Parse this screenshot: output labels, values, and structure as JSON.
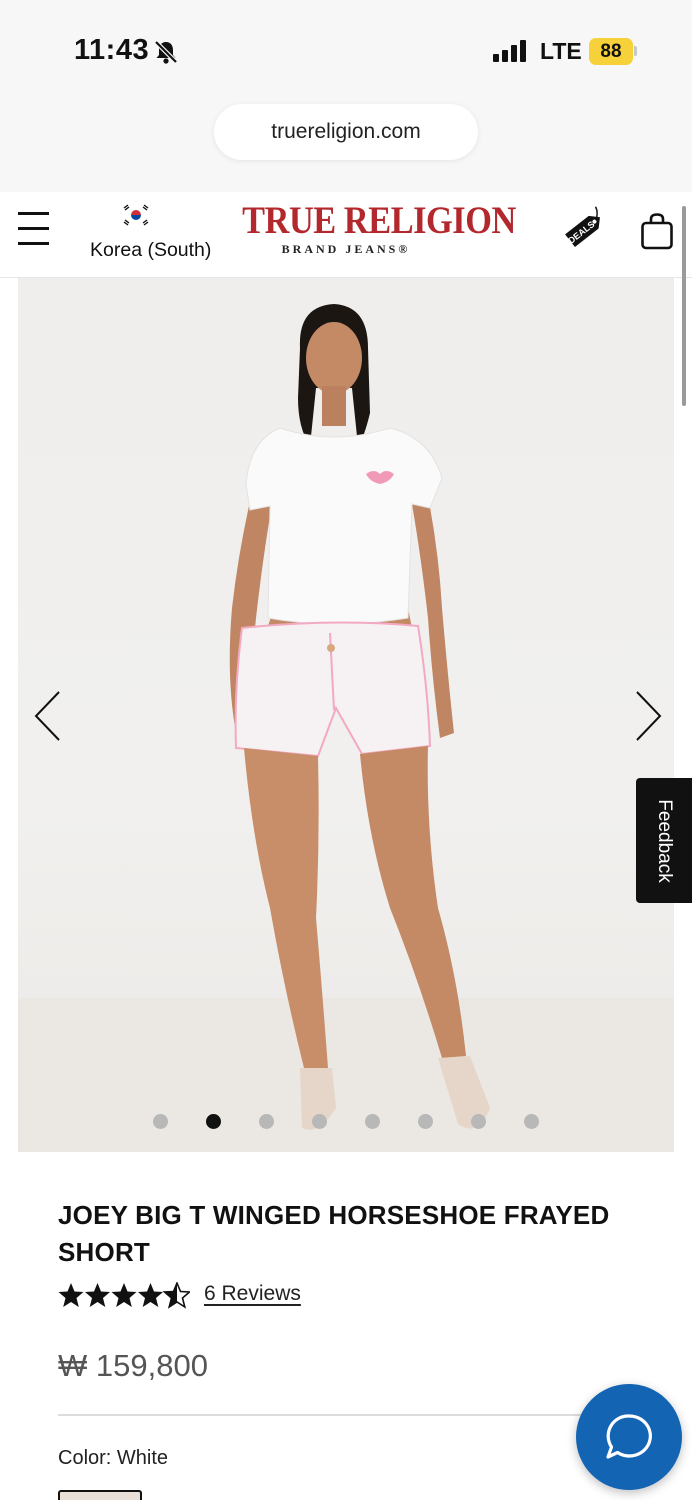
{
  "status_bar": {
    "time": "11:43",
    "network": "LTE",
    "battery": "88"
  },
  "browser": {
    "url": "truereligion.com"
  },
  "header": {
    "country": "Korea (South)",
    "logo_main": "TRUE RELIGION",
    "logo_sub": "BRAND JEANS®",
    "deals_label": "DEALS"
  },
  "gallery": {
    "slide_count": 8,
    "active_slide": 2
  },
  "feedback": {
    "label": "Feedback"
  },
  "product": {
    "title": "JOEY BIG T WINGED HORSESHOE FRAYED SHORT",
    "rating": 4.5,
    "reviews_label": "6 Reviews",
    "price": "₩ 159,800",
    "color_label": "Color: White"
  },
  "colors": {
    "brand_red": "#b3282d",
    "chat_blue": "#1464b4"
  }
}
